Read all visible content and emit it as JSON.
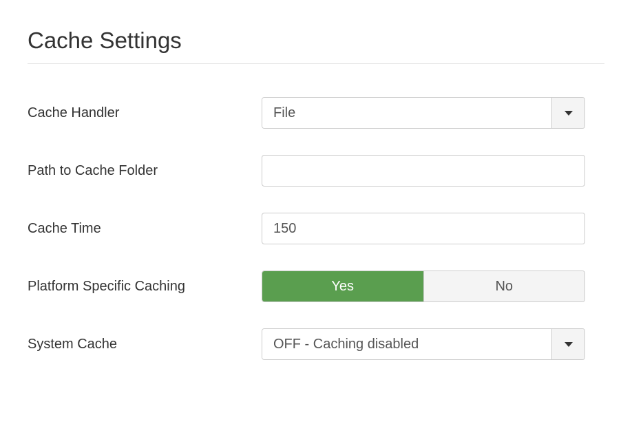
{
  "page": {
    "title": "Cache Settings"
  },
  "fields": {
    "cache_handler": {
      "label": "Cache Handler",
      "value": "File"
    },
    "path_to_cache_folder": {
      "label": "Path to Cache Folder",
      "value": ""
    },
    "cache_time": {
      "label": "Cache Time",
      "value": "150"
    },
    "platform_specific_caching": {
      "label": "Platform Specific Caching",
      "yes": "Yes",
      "no": "No",
      "selected": "Yes"
    },
    "system_cache": {
      "label": "System Cache",
      "value": "OFF - Caching disabled"
    }
  },
  "colors": {
    "active_toggle": "#5a9e4f"
  }
}
